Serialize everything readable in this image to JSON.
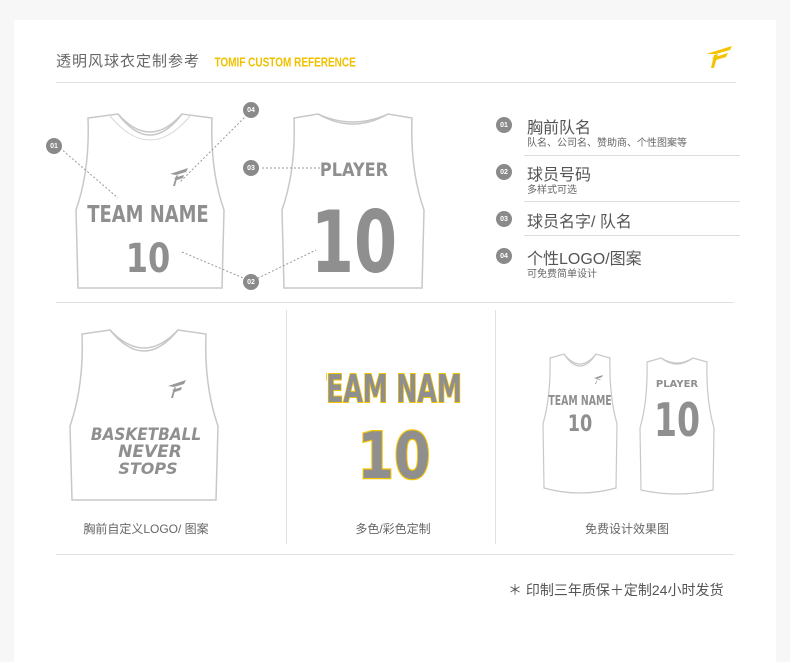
{
  "header": {
    "title": "透明风球衣定制参考",
    "subtitle": "TOMIF CUSTOM REFERENCE"
  },
  "jersey_front": {
    "team_name": "TEAM NAME",
    "number": "10"
  },
  "jersey_back": {
    "player": "PLAYER",
    "number": "10"
  },
  "callouts": [
    "01",
    "02",
    "03",
    "04"
  ],
  "features": [
    {
      "num": "01",
      "title": "胸前队名",
      "desc": "队名、公司名、赞助商、个性图案等"
    },
    {
      "num": "02",
      "title": "球员号码",
      "desc": "多样式可选"
    },
    {
      "num": "03",
      "title": "球员名字/ 队名",
      "desc": ""
    },
    {
      "num": "04",
      "title": "个性LOGO/图案",
      "desc": "可免费简单设计"
    }
  ],
  "panels": [
    {
      "caption": "胸前自定义LOGO/ 图案",
      "graphic_lines": [
        "BASKETBALL",
        "NEVER",
        "STOPS"
      ]
    },
    {
      "caption": "多色/彩色定制",
      "team_name": "TEAM NAME",
      "number": "10"
    },
    {
      "caption": "免费设计效果图",
      "team_name": "TEAM NAME",
      "number": "10",
      "player": "PLAYER"
    }
  ],
  "footnote": "＊ 印制三年质保＋定制24小时发货",
  "colors": {
    "accent_yellow": "#f5c400",
    "print_gray": "#8f8f8f",
    "outline_gray": "#c8c8c8",
    "badge_gray": "#8a8a8a"
  }
}
